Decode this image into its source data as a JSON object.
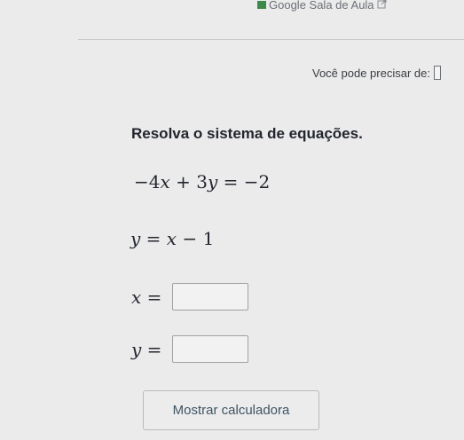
{
  "header": {
    "classroom_link": "Google Sala de Aula",
    "external_icon": "external-link-icon"
  },
  "hint": {
    "label": "Você pode precisar de:"
  },
  "question": {
    "prompt": "Resolva o sistema de equações.",
    "equation1": {
      "coef_x": "−4",
      "var_x": "x",
      "op": "+",
      "coef_y": "3",
      "var_y": "y",
      "eq": "=",
      "rhs": "−2"
    },
    "equation2": {
      "lhs": "y",
      "eq": "=",
      "var_x": "x",
      "op": "−",
      "rhs": "1"
    }
  },
  "answers": {
    "x_label": "x",
    "y_label": "y",
    "eq_sign": "=",
    "x_value": "",
    "y_value": ""
  },
  "actions": {
    "calculator_label": "Mostrar calculadora"
  },
  "colors": {
    "background": "#ebebec",
    "classroom_icon": "#3b8a4a",
    "button_text": "#3f5462"
  }
}
